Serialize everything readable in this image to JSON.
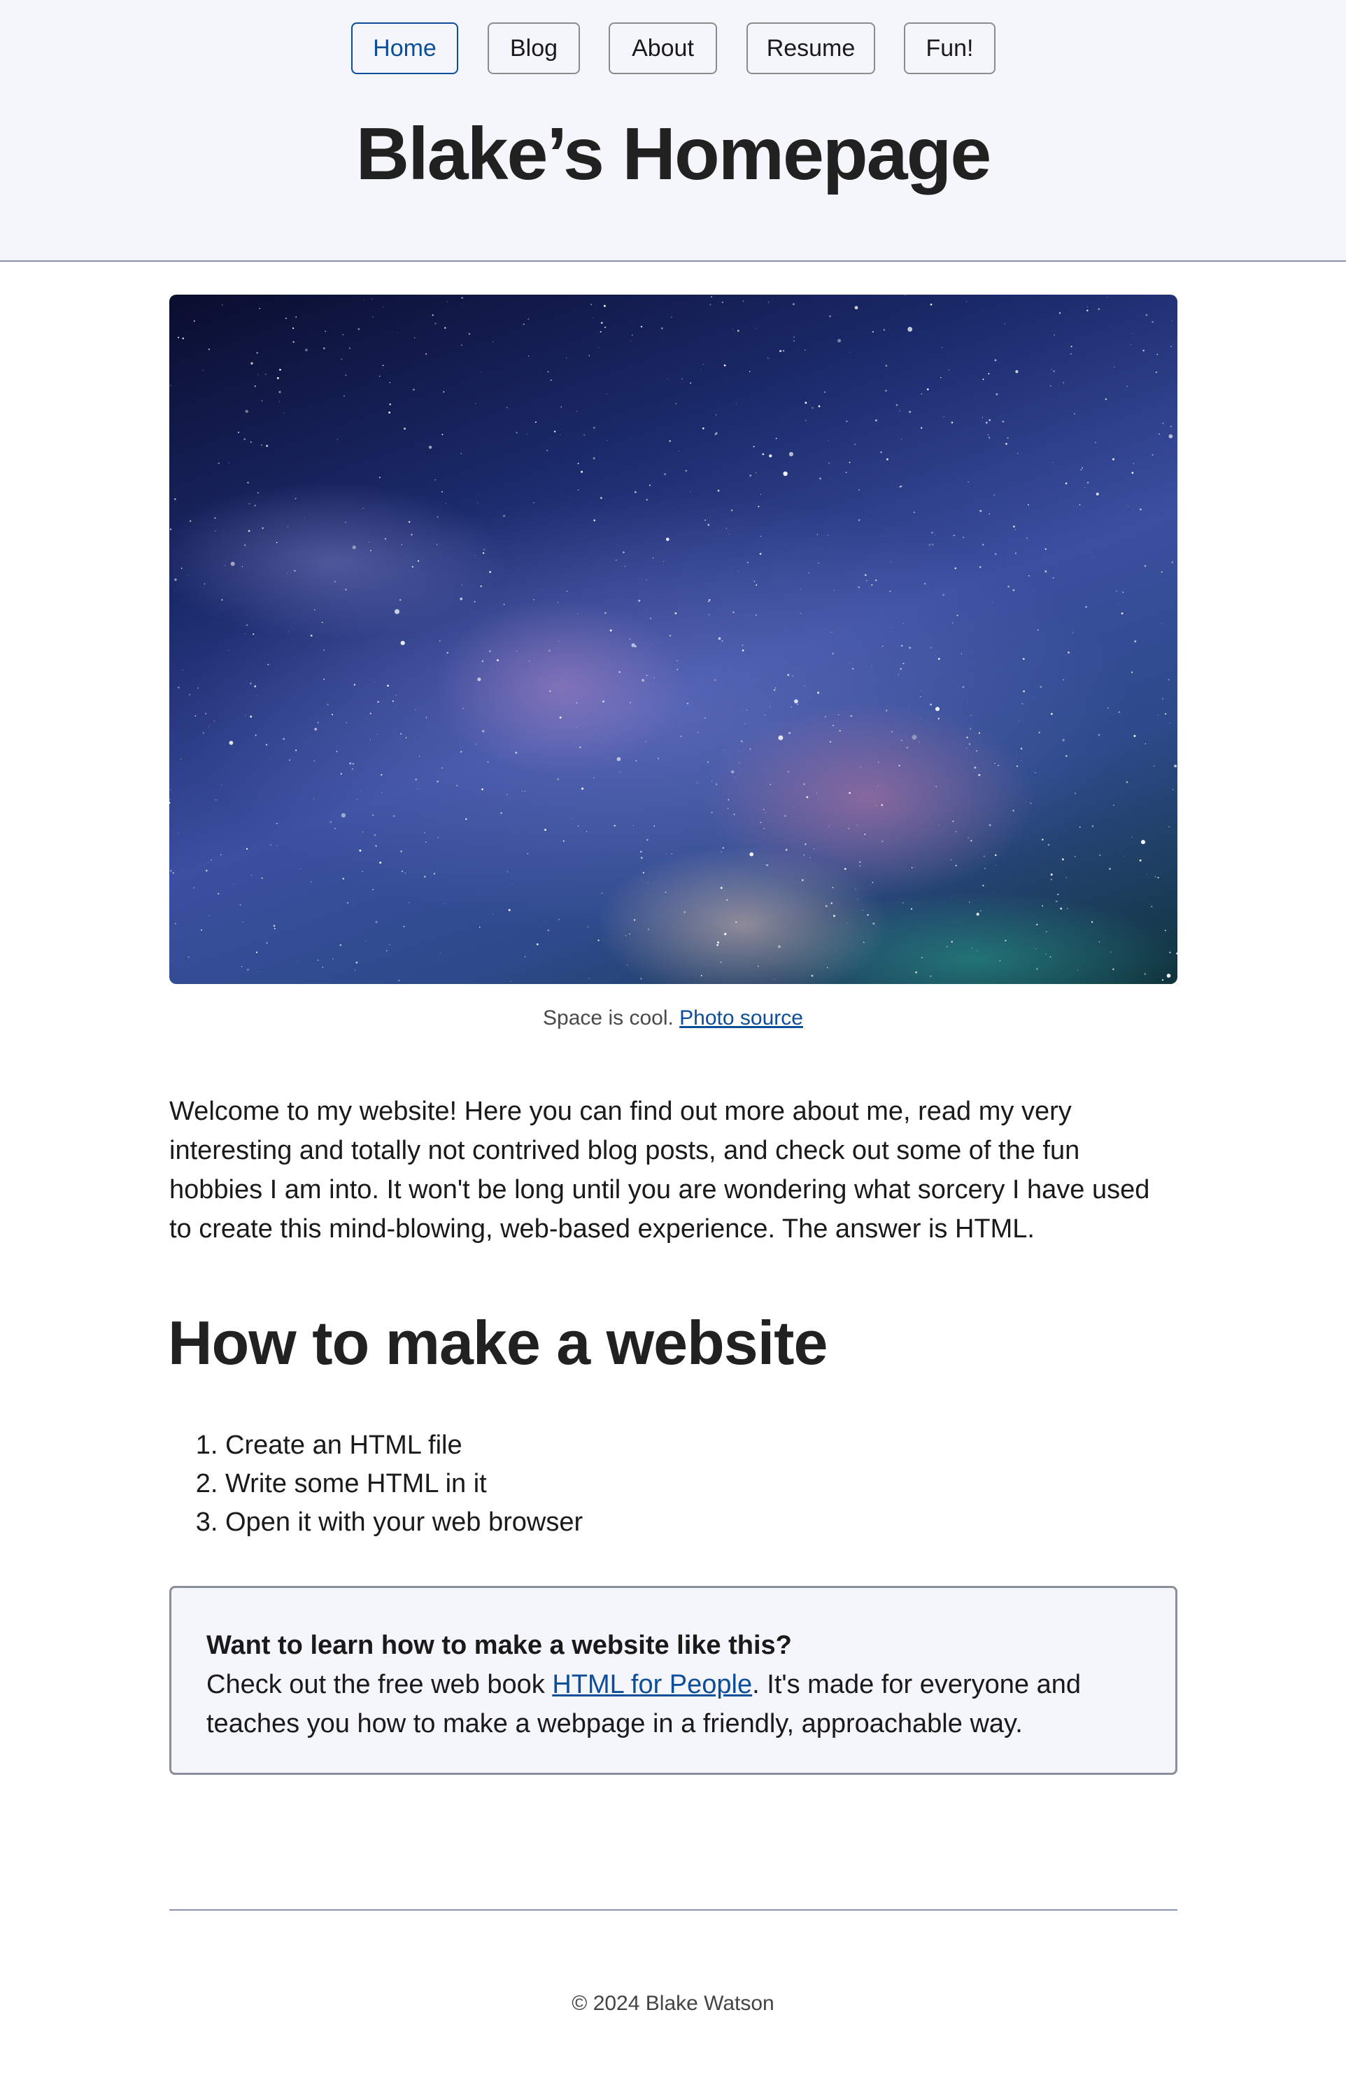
{
  "nav": {
    "items": [
      {
        "label": "Home",
        "active": true
      },
      {
        "label": "Blog",
        "active": false
      },
      {
        "label": "About",
        "active": false
      },
      {
        "label": "Resume",
        "active": false
      },
      {
        "label": "Fun!",
        "active": false
      }
    ]
  },
  "header": {
    "title": "Blake’s Homepage"
  },
  "hero": {
    "caption_text": "Space is cool.",
    "caption_link": "Photo source"
  },
  "intro": {
    "text": "Welcome to my website! Here you can find out more about me, read my very interesting and totally not contrived blog posts, and check out some of the fun hobbies I am into. It won't be long until you are wondering what sorcery I have used to create this mind-blowing, web-based experience. The answer is HTML."
  },
  "howto": {
    "heading": "How to make a website",
    "steps": [
      "Create an HTML file",
      "Write some HTML in it",
      "Open it with your web browser"
    ]
  },
  "callout": {
    "title": "Want to learn how to make a website like this?",
    "text_before": "Check out the free web book",
    "link": "HTML for People",
    "text_after": ". It's made for everyone and teaches you how to make a webpage in a friendly, approachable way."
  },
  "footer": {
    "text": "© 2024 Blake Watson"
  },
  "colors": {
    "header_bg": "#f4f6fc",
    "accent": "#0d4e9a",
    "text": "#212121"
  }
}
